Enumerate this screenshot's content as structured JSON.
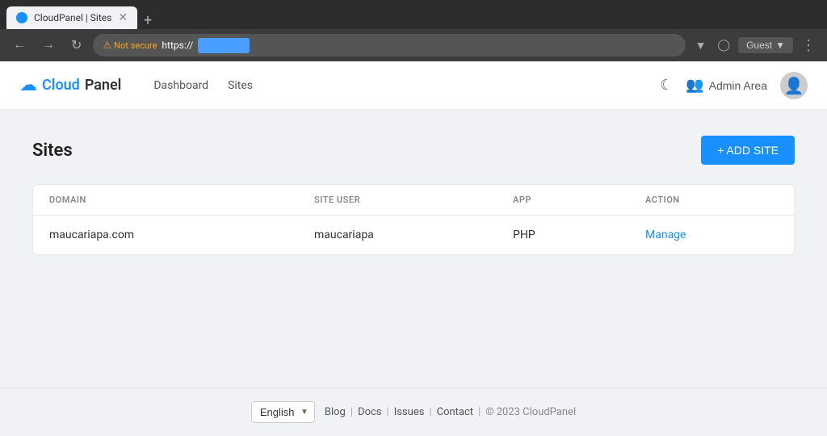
{
  "browser": {
    "tab_title": "CloudPanel | Sites",
    "tab_favicon": "☁",
    "not_secure_label": "Not secure",
    "url_prefix": "https://",
    "url_highlighted": "...",
    "guest_label": "Guest",
    "new_tab_label": "+"
  },
  "navbar": {
    "logo_cloud": "Cloud",
    "logo_panel": "Panel",
    "nav_dashboard": "Dashboard",
    "nav_sites": "Sites",
    "dark_mode_icon": "☾",
    "admin_area_label": "Admin Area",
    "user_icon": "👤"
  },
  "page": {
    "title": "Sites",
    "add_site_button": "+ ADD SITE"
  },
  "table": {
    "columns": [
      {
        "key": "domain",
        "label": "DOMAIN"
      },
      {
        "key": "site_user",
        "label": "SITE USER"
      },
      {
        "key": "app",
        "label": "APP"
      },
      {
        "key": "action",
        "label": "ACTION"
      }
    ],
    "rows": [
      {
        "domain": "maucariapa.com",
        "site_user": "maucariapa",
        "app": "PHP",
        "action": "Manage"
      }
    ]
  },
  "footer": {
    "language": "English",
    "links": [
      {
        "label": "Blog"
      },
      {
        "label": "Docs"
      },
      {
        "label": "Issues"
      },
      {
        "label": "Contact"
      }
    ],
    "copyright": "© 2023  CloudPanel"
  }
}
